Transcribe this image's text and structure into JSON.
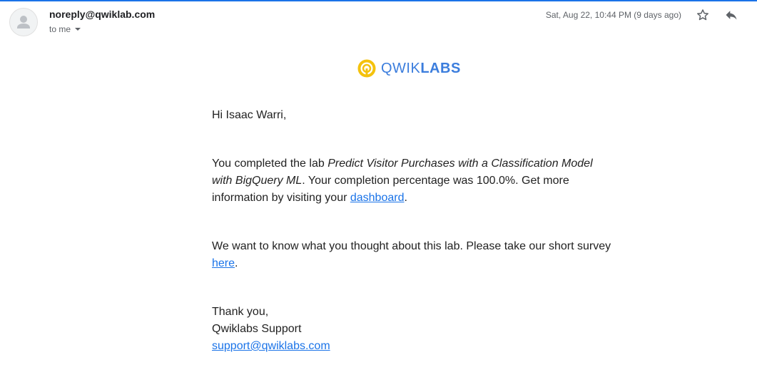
{
  "email": {
    "sender": "noreply@qwiklab.com",
    "recipient": "to me",
    "date": "Sat, Aug 22, 10:44 PM (9 days ago)"
  },
  "icons": {
    "avatar": "person-icon",
    "recipient_dropdown": "caret-down-icon",
    "star": "star-icon",
    "reply": "reply-icon",
    "logo": "qwiklabs-logo-icon"
  },
  "colors": {
    "accent": "#1a73e8",
    "logo_ring": "#f4c20d",
    "logo_text": "#3b7ddd"
  },
  "logo": {
    "part1": "QWIK",
    "part2": "LABS"
  },
  "body": {
    "greeting": "Hi Isaac Warri,",
    "lab_intro": "You completed the lab ",
    "lab_name": "Predict Visitor Purchases with a Classification Model with BigQuery ML",
    "lab_middle": ". Your completion percentage was 100.0%. Get more information by visiting your ",
    "dashboard_link": "dashboard",
    "lab_end": ".",
    "survey_text": "We want to know what you thought about this lab. Please take our short survey ",
    "survey_link": "here",
    "survey_end": ".",
    "signoff": "Thank you,",
    "signature": "Qwiklabs Support",
    "support_email": "support@qwiklabs.com"
  }
}
